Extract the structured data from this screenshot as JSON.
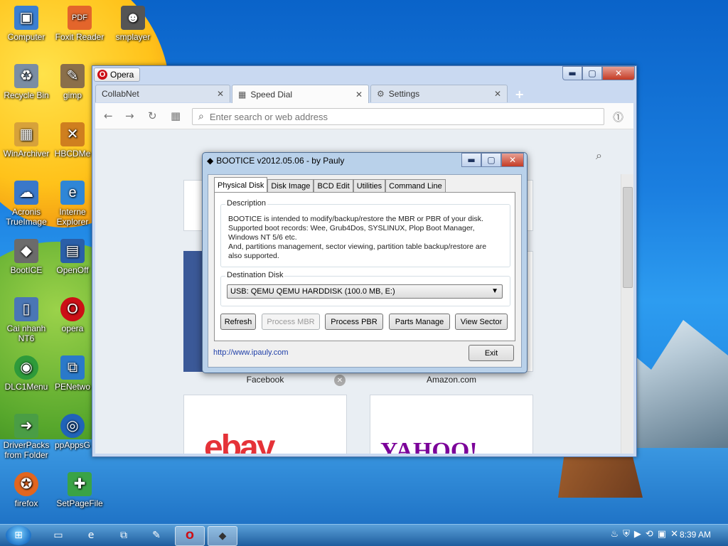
{
  "desktop": {
    "icons": [
      {
        "label": "Computer",
        "glyph": "▣",
        "color": "#3b7fd1"
      },
      {
        "label": "Foxit Reader",
        "glyph": "PDF",
        "color": "#e3652b"
      },
      {
        "label": "smplayer",
        "glyph": "☻",
        "color": "#555555"
      },
      {
        "label": "Recycle Bin",
        "glyph": "♻",
        "color": "#7a8da3"
      },
      {
        "label": "gimp",
        "glyph": "✎",
        "color": "#8a6f4a"
      },
      {
        "label": "WinArchiver",
        "glyph": "▦",
        "color": "#d7a23a"
      },
      {
        "label": "HBCDMe",
        "glyph": "✕",
        "color": "#cf7f1f"
      },
      {
        "label": "Acronis TrueImage",
        "glyph": "☁",
        "color": "#3a78c9"
      },
      {
        "label": "Interne Explorer",
        "glyph": "e",
        "color": "#2f86d6"
      },
      {
        "label": "BootICE",
        "glyph": "◆",
        "color": "#6b6b6b"
      },
      {
        "label": "OpenOff",
        "glyph": "▤",
        "color": "#2a5fa8"
      },
      {
        "label": "Cai nhanh NT6",
        "glyph": "▯",
        "color": "#4a76b5"
      },
      {
        "label": "opera",
        "glyph": "O",
        "color": "#cc0f16"
      },
      {
        "label": "DLC1Menu",
        "glyph": "◉",
        "color": "#2e9a3a"
      },
      {
        "label": "PENetwo",
        "glyph": "⧉",
        "color": "#2a79c9"
      },
      {
        "label": "DriverPacks from Folder",
        "glyph": "➜",
        "color": "#4a9d45"
      },
      {
        "label": "ppAppsG",
        "glyph": "◎",
        "color": "#2063b8"
      },
      {
        "label": "firefox",
        "glyph": "✪",
        "color": "#e2661f"
      },
      {
        "label": "SetPageFile",
        "glyph": "✚",
        "color": "#3aa346"
      }
    ]
  },
  "opera": {
    "app_button": "Opera",
    "controls": {
      "minimize": "▬",
      "maximize": "▢",
      "close": "✕"
    },
    "tabs": [
      {
        "label": "CollabNet",
        "icon": "",
        "close": "✕"
      },
      {
        "label": "Speed Dial",
        "icon": "▦",
        "close": "✕"
      },
      {
        "label": "Settings",
        "icon": "⚙",
        "close": "✕"
      }
    ],
    "new_tab": "+",
    "nav": {
      "back": "←",
      "forward": "→",
      "reload": "↻",
      "speed_dial": "▦",
      "search_icon": "⌕",
      "update": "⓵"
    },
    "address_placeholder": "Enter search or web address",
    "speed_dial": {
      "search_icon": "⌕",
      "tiles": [
        {
          "label": "Facebook",
          "close": "✕"
        },
        {
          "label": "Amazon.com"
        },
        {
          "label": "ebay",
          "brand": "ebay"
        },
        {
          "label": "Yahoo",
          "brand": "YAHOO!"
        }
      ]
    }
  },
  "bootice": {
    "title": "BOOTICE v2012.05.06 - by Pauly",
    "controls": {
      "minimize": "▬",
      "maximize": "▢",
      "close": "✕"
    },
    "tabs": [
      "Physical Disk",
      "Disk Image",
      "BCD Edit",
      "Utilities",
      "Command Line"
    ],
    "description_label": "Description",
    "description": [
      "BOOTICE is intended to modify/backup/restore the MBR or PBR of your disk.",
      "Supported boot records: Wee, Grub4Dos, SYSLINUX, Plop Boot Manager,",
      "Windows NT 5/6 etc.",
      "And, partitions management, sector viewing, partition table backup/restore are",
      "also supported."
    ],
    "destination_label": "Destination Disk",
    "destination_value": "USB: QEMU    QEMU HARDDISK (100.0 MB, E:)",
    "buttons": {
      "refresh": "Refresh",
      "process_mbr": "Process MBR",
      "process_pbr": "Process PBR",
      "parts_manage": "Parts Manage",
      "view_sector": "View Sector",
      "exit": "Exit"
    },
    "link": "http://www.ipauly.com"
  },
  "taskbar": {
    "start": "⊞",
    "items": [
      {
        "name": "explorer",
        "glyph": "▭",
        "active": false
      },
      {
        "name": "ie",
        "glyph": "e",
        "active": false
      },
      {
        "name": "network",
        "glyph": "⧉",
        "active": false
      },
      {
        "name": "notes",
        "glyph": "✎",
        "active": false
      },
      {
        "name": "opera",
        "glyph": "O",
        "active": true
      },
      {
        "name": "bootice",
        "glyph": "◆",
        "active": true
      }
    ],
    "tray_icons": [
      "♨",
      "⛨",
      "▶",
      "⟲",
      "▣",
      "✕"
    ],
    "clock": "8:39 AM"
  }
}
